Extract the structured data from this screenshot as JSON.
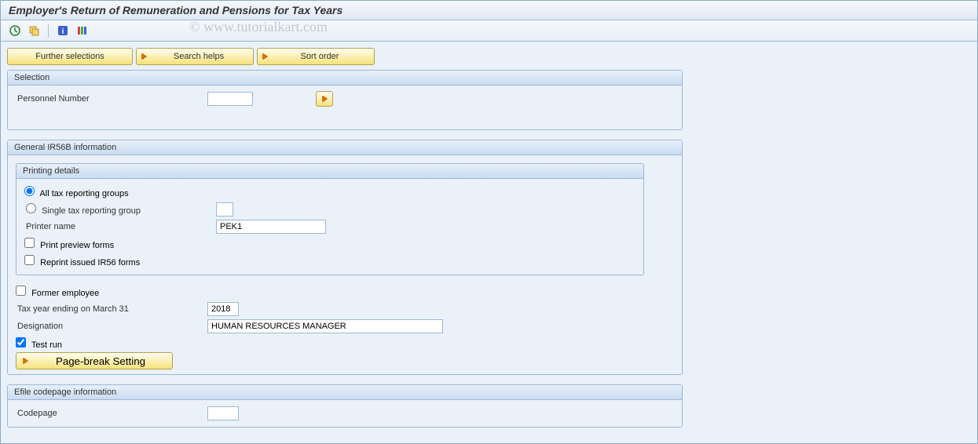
{
  "title": "Employer's Return of Remuneration and Pensions for Tax Years",
  "watermark": "© www.tutorialkart.com",
  "buttons": {
    "further_selections": "Further selections",
    "search_helps": "Search helps",
    "sort_order": "Sort order"
  },
  "selection": {
    "title": "Selection",
    "personnel_number_label": "Personnel Number",
    "personnel_number_value": ""
  },
  "general": {
    "title": "General IR56B information",
    "printing": {
      "title": "Printing details",
      "opt_all": "All tax reporting groups",
      "opt_single": "Single tax reporting group",
      "single_value": "",
      "printer_name_label": "Printer name",
      "printer_name_value": "PEK1",
      "chk_preview": "Print preview forms",
      "chk_reprint": "Reprint issued IR56 forms"
    },
    "former_employee": "Former employee",
    "tax_year_label": "Tax year ending on March 31",
    "tax_year_value": "2018",
    "designation_label": "Designation",
    "designation_value": "HUMAN RESOURCES MANAGER",
    "test_run": "Test run",
    "page_break": "Page-break Setting"
  },
  "efile": {
    "title": "Efile codepage information",
    "codepage_label": "Codepage",
    "codepage_value": ""
  }
}
